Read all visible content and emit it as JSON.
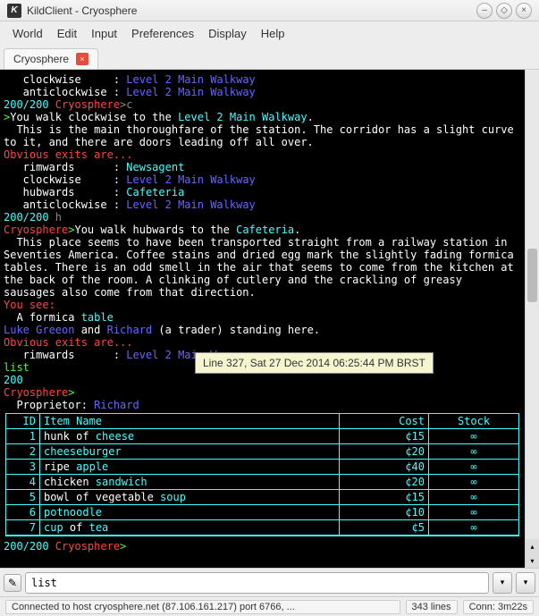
{
  "window": {
    "title": "KildClient - Cryosphere"
  },
  "menu": [
    "World",
    "Edit",
    "Input",
    "Preferences",
    "Display",
    "Help"
  ],
  "tab": {
    "label": "Cryosphere"
  },
  "term": {
    "l1a": "   clockwise     : ",
    "l1b": "Level 2 Main Walkway",
    "l2a": "   anticlockwise : ",
    "l2b": "Level 2 Main Walkway",
    "l3a": "200/200 ",
    "l3b": "Cryosphere",
    "l3c": ">c",
    "l4a": ">",
    "l4b": "You walk clockwise to the ",
    "l4c": "Level 2 Main Walkway",
    "l4d": ".",
    "l5": "  This is the main thoroughfare of the station. The corridor has a slight curve",
    "l6": "to it, and there are doors leading off all over.",
    "l7": "Obvious exits are...",
    "l8a": "   rimwards      : ",
    "l8b": "Newsagent",
    "l9a": "   clockwise     : ",
    "l9b": "Level 2 Main Walkway",
    "l10a": "   hubwards      : ",
    "l10b": "Cafeteria",
    "l11a": "   anticlockwise : ",
    "l11b": "Level 2 Main Walkway",
    "l12a": "200/200 ",
    "l12b": "h",
    "l13a": "Cryosphere",
    "l13b": ">",
    "l13c": "You walk hubwards to the ",
    "l13d": "Cafeteria",
    "l13e": ".",
    "l14": "  This place seems to have been transported straight from a railway station in",
    "l15": "Seventies America. Coffee stains and dried egg mark the slightly fading formica",
    "l16": "tables. There is an odd smell in the air that seems to come from the kitchen at",
    "l17": "the back of the room. A clinking of cutlery and the crackling of greasy",
    "l18": "sausages also come from that direction.",
    "l19": "You see:",
    "l20a": "  A formica ",
    "l20b": "table",
    "l21a": "Luke Greeon",
    "l21b": " and ",
    "l21c": "Richard",
    "l21d": " (a trader) standing here.",
    "l22": "Obvious exits are...",
    "l23a": "   rimwards      : ",
    "l23b": "Level 2 Main W",
    "l24": "list",
    "l25": "200",
    "l26a": "Cryosphere",
    "l26b": ">",
    "propLabel": "  Proprietor",
    "propSep": ": ",
    "propName": "Richard",
    "hdr": {
      "id": "ID",
      "name": "Item Name",
      "cost": "Cost",
      "stock": "Stock"
    },
    "rows": [
      {
        "id": "1",
        "n1": "hunk of ",
        "n2": "cheese",
        "n3": "",
        "cost": "¢15",
        "stock": "∞"
      },
      {
        "id": "2",
        "n1": "",
        "n2": "cheeseburger",
        "n3": "",
        "cost": "¢20",
        "stock": "∞"
      },
      {
        "id": "3",
        "n1": "ripe ",
        "n2": "apple",
        "n3": "",
        "cost": "¢40",
        "stock": "∞"
      },
      {
        "id": "4",
        "n1": "chicken ",
        "n2": "sandwich",
        "n3": "",
        "cost": "¢20",
        "stock": "∞"
      },
      {
        "id": "5",
        "n1": "bowl of vegetable ",
        "n2": "soup",
        "n3": "",
        "cost": "¢15",
        "stock": "∞"
      },
      {
        "id": "6",
        "n1": "",
        "n2": "potnoodle",
        "n3": "",
        "cost": "¢10",
        "stock": "∞"
      },
      {
        "id": "7",
        "n1": "",
        "n2": "cup",
        "n3": " of ",
        "n4": "tea",
        "cost": "¢5",
        "stock": "∞"
      }
    ],
    "p1a": "200/200 ",
    "p1b": "Cryosphere",
    "p1c": ">"
  },
  "tooltip": "Line 327, Sat 27 Dec 2014 06:25:44 PM BRST",
  "input": {
    "value": "list"
  },
  "status": {
    "conn": "Connected to host cryosphere.net (87.106.161.217) port 6766, ...",
    "lines": "343 lines",
    "time": "Conn: 3m22s"
  }
}
